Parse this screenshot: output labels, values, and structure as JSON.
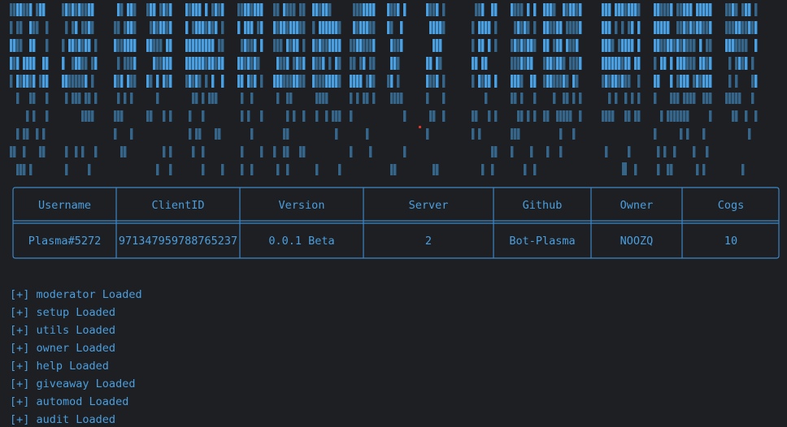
{
  "theme": {
    "background": "#1e1f22",
    "accent": "#4a9fe0",
    "border": "#3d86c6",
    "dot": "#d8342a"
  },
  "info_table": {
    "headers": [
      "Username",
      "ClientID",
      "Version",
      "Server",
      "Github",
      "Owner",
      "Cogs"
    ],
    "rows": [
      [
        "Plasma#5272",
        "971347959788765237",
        "0.0.1 Beta",
        "2",
        "Bot-Plasma",
        "NOOZQ",
        "10"
      ]
    ]
  },
  "log": {
    "lines": [
      {
        "prefix": "[+]",
        "text": "moderator Loaded"
      },
      {
        "prefix": "[+]",
        "text": "setup Loaded"
      },
      {
        "prefix": "[+]",
        "text": "utils Loaded"
      },
      {
        "prefix": "[+]",
        "text": "owner Loaded"
      },
      {
        "prefix": "[+]",
        "text": "help Loaded"
      },
      {
        "prefix": "[+]",
        "text": "giveaway Loaded"
      },
      {
        "prefix": "[+]",
        "text": "automod Loaded"
      },
      {
        "prefix": "[+]",
        "text": "audit Loaded"
      }
    ]
  }
}
